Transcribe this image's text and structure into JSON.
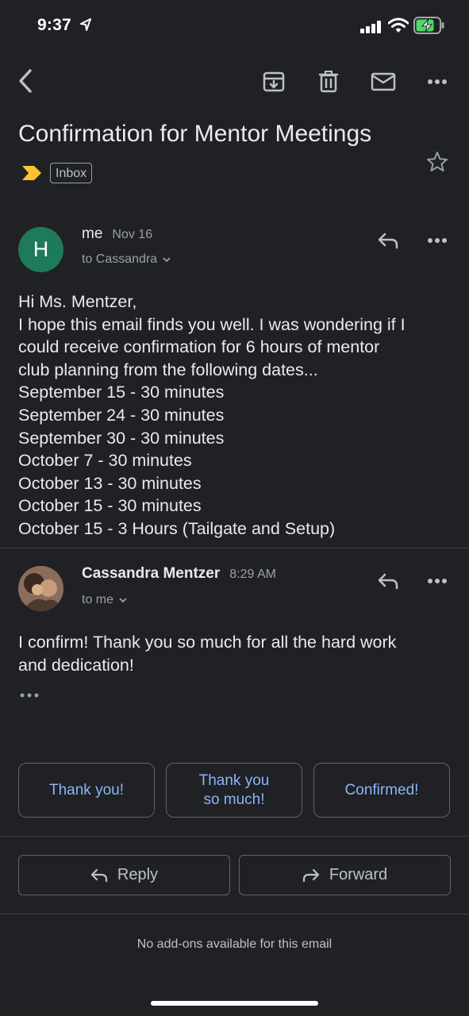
{
  "status_bar": {
    "time": "9:37"
  },
  "email": {
    "subject": "Confirmation for Mentor Meetings",
    "label": "Inbox",
    "messages": [
      {
        "avatar_letter": "H",
        "sender": "me",
        "date": "Nov 16",
        "recipient": "to Cassandra",
        "body_lines": [
          "Hi Ms. Mentzer,",
          "I hope this email finds you well. I was wondering if I",
          "could receive confirmation for 6 hours of mentor",
          "club planning from the following dates...",
          "September 15 - 30 minutes",
          "September 24 - 30 minutes",
          "September 30 - 30 minutes",
          "October 7 - 30 minutes",
          "October 13 - 30 minutes",
          "October 15 - 30 minutes",
          "October 15 - 3 Hours (Tailgate and Setup)"
        ]
      },
      {
        "sender": "Cassandra Mentzer",
        "date": "8:29 AM",
        "recipient": "to me",
        "body_lines": [
          "I confirm! Thank you so much for all the hard work",
          "and dedication!"
        ]
      }
    ]
  },
  "smart_replies": [
    "Thank you!",
    "Thank you\nso much!",
    "Confirmed!"
  ],
  "actions": {
    "reply": "Reply",
    "forward": "Forward"
  },
  "addons_text": "No add-ons available for this email",
  "colors": {
    "background": "#202124",
    "link": "#8ab4f8",
    "important_marker": "#f9c430",
    "avatar_bg": "#1f7a5a"
  }
}
